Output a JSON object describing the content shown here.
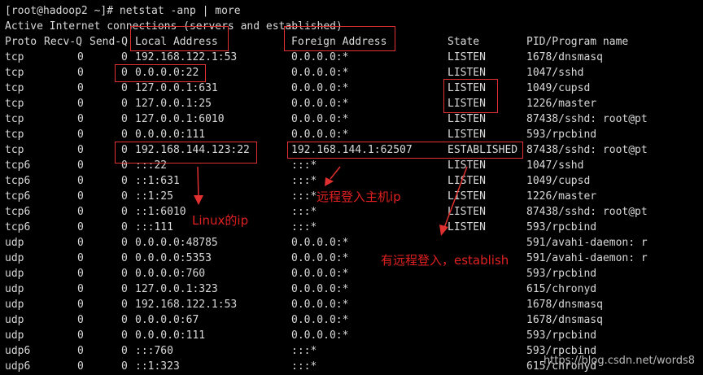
{
  "terminal": {
    "prompt_line": "[root@hadoop2 ~]# netstat -anp | more",
    "info_line": "Active Internet connections (servers and established)",
    "headers": {
      "proto": "Proto",
      "recvq": "Recv-Q",
      "sendq": "Send-Q",
      "local": "Local Address",
      "foreign": "Foreign Address",
      "state": "State",
      "pid": "PID/Program name"
    },
    "rows": [
      {
        "proto": "tcp",
        "recvq": "0",
        "sendq": "0",
        "local": "192.168.122.1:53",
        "foreign": "0.0.0.0:*",
        "state": "LISTEN",
        "pid": "1678/dnsmasq"
      },
      {
        "proto": "tcp",
        "recvq": "0",
        "sendq": "0",
        "local": "0.0.0.0:22",
        "foreign": "0.0.0.0:*",
        "state": "LISTEN",
        "pid": "1047/sshd"
      },
      {
        "proto": "tcp",
        "recvq": "0",
        "sendq": "0",
        "local": "127.0.0.1:631",
        "foreign": "0.0.0.0:*",
        "state": "LISTEN",
        "pid": "1049/cupsd"
      },
      {
        "proto": "tcp",
        "recvq": "0",
        "sendq": "0",
        "local": "127.0.0.1:25",
        "foreign": "0.0.0.0:*",
        "state": "LISTEN",
        "pid": "1226/master"
      },
      {
        "proto": "tcp",
        "recvq": "0",
        "sendq": "0",
        "local": "127.0.0.1:6010",
        "foreign": "0.0.0.0:*",
        "state": "LISTEN",
        "pid": "87438/sshd: root@pt"
      },
      {
        "proto": "tcp",
        "recvq": "0",
        "sendq": "0",
        "local": "0.0.0.0:111",
        "foreign": "0.0.0.0:*",
        "state": "LISTEN",
        "pid": "593/rpcbind"
      },
      {
        "proto": "tcp",
        "recvq": "0",
        "sendq": "0",
        "local": "192.168.144.123:22",
        "foreign": "192.168.144.1:62507",
        "state": "ESTABLISHED",
        "pid": "87438/sshd: root@pt"
      },
      {
        "proto": "tcp6",
        "recvq": "0",
        "sendq": "0",
        "local": ":::22",
        "foreign": ":::*",
        "state": "LISTEN",
        "pid": "1047/sshd"
      },
      {
        "proto": "tcp6",
        "recvq": "0",
        "sendq": "0",
        "local": "::1:631",
        "foreign": ":::*",
        "state": "LISTEN",
        "pid": "1049/cupsd"
      },
      {
        "proto": "tcp6",
        "recvq": "0",
        "sendq": "0",
        "local": "::1:25",
        "foreign": ":::*",
        "state": "LISTEN",
        "pid": "1226/master"
      },
      {
        "proto": "tcp6",
        "recvq": "0",
        "sendq": "0",
        "local": "::1:6010",
        "foreign": ":::*",
        "state": "LISTEN",
        "pid": "87438/sshd: root@pt"
      },
      {
        "proto": "tcp6",
        "recvq": "0",
        "sendq": "0",
        "local": ":::111",
        "foreign": ":::*",
        "state": "LISTEN",
        "pid": "593/rpcbind"
      },
      {
        "proto": "udp",
        "recvq": "0",
        "sendq": "0",
        "local": "0.0.0.0:48785",
        "foreign": "0.0.0.0:*",
        "state": "",
        "pid": "591/avahi-daemon: r"
      },
      {
        "proto": "udp",
        "recvq": "0",
        "sendq": "0",
        "local": "0.0.0.0:5353",
        "foreign": "0.0.0.0:*",
        "state": "",
        "pid": "591/avahi-daemon: r"
      },
      {
        "proto": "udp",
        "recvq": "0",
        "sendq": "0",
        "local": "0.0.0.0:760",
        "foreign": "0.0.0.0:*",
        "state": "",
        "pid": "593/rpcbind"
      },
      {
        "proto": "udp",
        "recvq": "0",
        "sendq": "0",
        "local": "127.0.0.1:323",
        "foreign": "0.0.0.0:*",
        "state": "",
        "pid": "615/chronyd"
      },
      {
        "proto": "udp",
        "recvq": "0",
        "sendq": "0",
        "local": "192.168.122.1:53",
        "foreign": "0.0.0.0:*",
        "state": "",
        "pid": "1678/dnsmasq"
      },
      {
        "proto": "udp",
        "recvq": "0",
        "sendq": "0",
        "local": "0.0.0.0:67",
        "foreign": "0.0.0.0:*",
        "state": "",
        "pid": "1678/dnsmasq"
      },
      {
        "proto": "udp",
        "recvq": "0",
        "sendq": "0",
        "local": "0.0.0.0:111",
        "foreign": "0.0.0.0:*",
        "state": "",
        "pid": "593/rpcbind"
      },
      {
        "proto": "udp6",
        "recvq": "0",
        "sendq": "0",
        "local": ":::760",
        "foreign": ":::*",
        "state": "",
        "pid": "593/rpcbind"
      },
      {
        "proto": "udp6",
        "recvq": "0",
        "sendq": "0",
        "local": "::1:323",
        "foreign": ":::*",
        "state": "",
        "pid": "615/chronyd"
      }
    ]
  },
  "annotations": {
    "linux_ip": "Linux的ip",
    "remote_ip": "远程登入主机ip",
    "remote_established": "有远程登入，establish"
  },
  "watermark": "https://blog.csdn.net/words8",
  "colors": {
    "background": "#000000",
    "text": "#d9d9d9",
    "annotation": "#e03030"
  }
}
